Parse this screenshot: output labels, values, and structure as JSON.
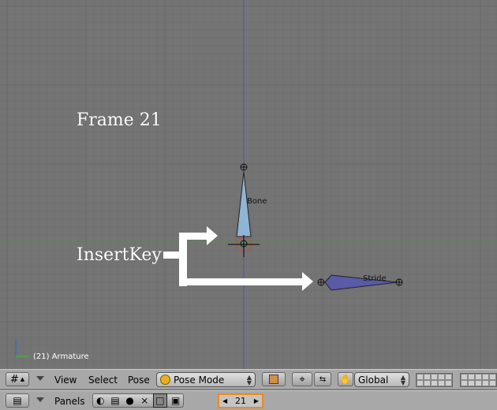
{
  "viewport": {
    "frame_label": "Frame 21",
    "insertkey_label": "InsertKey",
    "bones": [
      {
        "name": "Bone"
      },
      {
        "name": "Stride"
      }
    ],
    "status_label": "(21) Armature"
  },
  "header1": {
    "menus": [
      "View",
      "Select",
      "Pose"
    ],
    "mode_dropdown": "Pose Mode",
    "orientation_dropdown": "Global"
  },
  "header2": {
    "panels_label": "Panels",
    "current_frame": "21"
  },
  "colors": {
    "background": "#747474",
    "grid": "#6b6b6b",
    "x_axis": "#5a8a4a",
    "y_axis": "#5050c0",
    "bone_fill": "#8fb4d6",
    "stride_fill": "#5a5aa8",
    "frame_highlight": "#f08a1c"
  }
}
